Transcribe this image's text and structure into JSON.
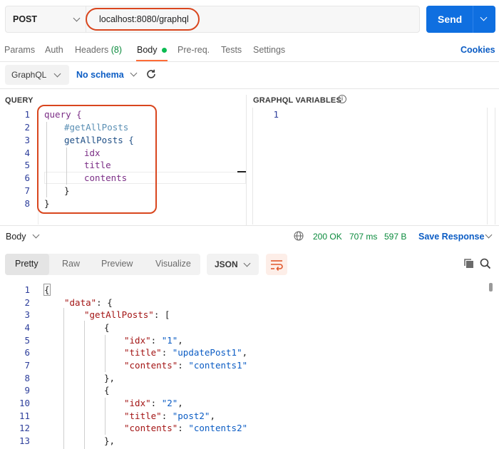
{
  "request": {
    "method": "POST",
    "url": "localhost:8080/graphql",
    "send_label": "Send"
  },
  "tabs": [
    {
      "label": "Params"
    },
    {
      "label": "Auth"
    },
    {
      "label": "Headers",
      "count": "(8)"
    },
    {
      "label": "Body"
    },
    {
      "label": "Pre-req."
    },
    {
      "label": "Tests"
    },
    {
      "label": "Settings"
    }
  ],
  "cookies_label": "Cookies",
  "body_type": {
    "mode": "GraphQL",
    "schema": "No schema"
  },
  "query": {
    "title": "QUERY",
    "line_numbers": [
      "1",
      "2",
      "3",
      "4",
      "5",
      "6",
      "7",
      "8"
    ],
    "lines": [
      "query {",
      "#getAllPosts",
      "getAllPosts {",
      "idx",
      "title",
      "contents",
      "}",
      "}"
    ]
  },
  "variables": {
    "title": "GRAPHQL VARIABLES",
    "info_icon": "info-icon",
    "line_numbers": [
      "1"
    ]
  },
  "response": {
    "body_label": "Body",
    "status": "200 OK",
    "time": "707 ms",
    "size": "597 B",
    "save_label": "Save Response",
    "view_tabs": [
      "Pretty",
      "Raw",
      "Preview",
      "Visualize"
    ],
    "format": "JSON",
    "line_numbers": [
      "1",
      "2",
      "3",
      "4",
      "5",
      "6",
      "7",
      "8",
      "9",
      "10",
      "11",
      "12",
      "13"
    ],
    "posts": [
      {
        "idx": "1",
        "title": "updatePost1",
        "contents": "contents1"
      },
      {
        "idx": "2",
        "title": "post2",
        "contents": "contents2"
      }
    ]
  },
  "colors": {
    "accent": "#ff6c37",
    "send": "#0f6fe0",
    "link": "#0b5cc4",
    "status_ok": "#0a8a3c",
    "highlight": "#d9461e"
  }
}
